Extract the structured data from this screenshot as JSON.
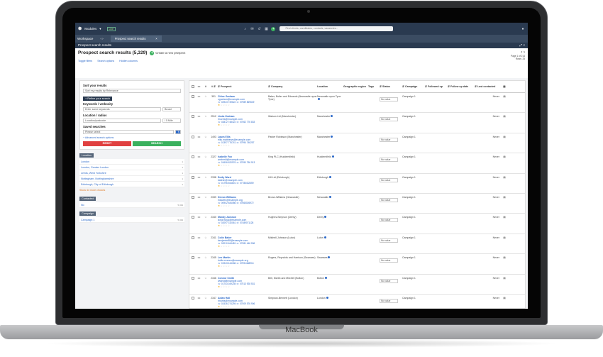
{
  "device": {
    "brand": "MacBook"
  },
  "topbar": {
    "modules_label": "Modules",
    "tag_label": "Live",
    "search_placeholder": "Find clients, candidates, contacts, vacancies..."
  },
  "tabs": {
    "workspace_label": "Workspace",
    "active_tab_label": "Prospect search results",
    "close_glyph": "×"
  },
  "window": {
    "title": "Prospect search results"
  },
  "header": {
    "title": "Prospect search results (5,329)",
    "add_label": "Create a new prospect",
    "links": [
      "Toggle filters",
      "Search options",
      "Hidden columns"
    ],
    "pager_line1": "Page 1 of 214",
    "pager_line2": "Rows: 25"
  },
  "sidebar": {
    "sort_label": "Sort your results",
    "sort_value": "Sort my results by Relevance",
    "refine_label": "+ Refine your search",
    "keywords_label": "Keywords / verbosity",
    "keywords_placeholder": "Enter some keywords",
    "verbosity_value": "Broad",
    "location_label": "Location / radius",
    "location_placeholder": "Location/postcode",
    "radius_value": "/ 5 Mile",
    "saved_label": "Saved searches",
    "saved_placeholder": "Please select",
    "advanced_link": "+ Advanced search options",
    "reset_label": "RESET",
    "search_label": "SEARCH",
    "location_filter": {
      "header": "Location",
      "items": [
        {
          "label": "London",
          "count": "1"
        },
        {
          "label": "London, Greater London",
          "count": "1"
        },
        {
          "label": "Leeds, West Yorkshire",
          "count": "1"
        },
        {
          "label": "Nottingham, Nottinghamshire",
          "count": "1"
        },
        {
          "label": "Edinburgh, City of Edinburgh",
          "count": "1"
        }
      ],
      "more_label": "Show 44 more choices"
    },
    "contacted_filter": {
      "header": "Contacted",
      "items": [
        {
          "label": "No",
          "count": "5,329"
        }
      ]
    },
    "campaign_filter": {
      "header": "Campaign",
      "items": [
        {
          "label": "Campaign 1",
          "count": "5,329"
        }
      ]
    }
  },
  "table": {
    "headers": [
      "",
      "",
      "#",
      "# ⇵",
      "⇵ Prospect",
      "⇵ Company",
      "Location",
      "Geographic region",
      "Tags",
      "⇵ Status",
      "⇵ Campaign",
      "⇵ Followed up",
      "⇵ Follow up date",
      "⇵ Last contacted",
      ""
    ],
    "status_value": "No value",
    "rows": [
      {
        "id": "351",
        "name": "Chloe Graham",
        "email": "cgraham@example.com",
        "phones": "☏ 02923 749622  ☏ 07989 869649",
        "stars": 1,
        "company": "Baker, Butler and Edwards (Newcastle upon Tyne)",
        "location": "Newcastle upon Tyne",
        "campaign": "Campaign 1",
        "last": "Never"
      },
      {
        "id": "2512",
        "name": "Linda Graham",
        "email": "lmorris@example.com",
        "phones": "☏ 02812 748422  ☏ 07062 776 833",
        "stars": 1,
        "company": "Watson Ltd (Manchester)",
        "location": "Manchester",
        "campaign": "Campaign 1",
        "last": "Never"
      },
      {
        "id": "1493",
        "name": "Laura Ellis",
        "email": "ellis.matthews@example.com",
        "phones": "☏ 01397 776741  ☏ 07994 746257",
        "stars": 1,
        "company": "Parker Robinson (Manchester)",
        "location": "Manchester",
        "campaign": "Campaign 1",
        "last": "Never"
      },
      {
        "id": "2327",
        "name": "Isabelle Fox",
        "email": "amberld@example.com",
        "phones": "☏ 01606 620976  ☏ 07090 756 913",
        "stars": 1,
        "company": "King PLC (Huddersfield)",
        "location": "Huddersfield",
        "campaign": "Campaign 1",
        "last": "Never"
      },
      {
        "id": "2338",
        "name": "Emily Ward",
        "email": "katesh@example.com",
        "phones": "☏ 01796 464801  ☏ 07786432659",
        "stars": 1,
        "company": "Hill Ltd (Edinburgh)",
        "location": "Edinburgh",
        "campaign": "Campaign 1",
        "last": "Never"
      },
      {
        "id": "2339",
        "name": "Kieran Williams",
        "email": "edavies@example.org",
        "phones": "☏ 00902 484086  ☏ 07665026972",
        "stars": 1,
        "company": "Brown-Williams (Newcastle)",
        "location": "Newcastle",
        "campaign": "Campaign 1",
        "last": "Never"
      },
      {
        "id": "2340",
        "name": "Mandy Jackson",
        "email": "lloyd.fraya@example.com",
        "phones": "☏ 02097 310061  ☏ 07489071128",
        "stars": 1,
        "company": "Hughes-Simpson (Derby)",
        "location": "Derby",
        "campaign": "Campaign 1",
        "last": "Never"
      },
      {
        "id": "2341",
        "name": "Colin Baker",
        "email": "benjamin88@example.com",
        "phones": "☏ 02010 464481  ☏ 07081 446 536",
        "stars": 1,
        "company": "Mitchell-Johnson (Luton)",
        "location": "Luton",
        "campaign": "Campaign 1",
        "last": "Never"
      },
      {
        "id": "2345",
        "name": "Leo Martin",
        "email": "hollie.evereu@example.org",
        "phones": "☏ 01943 444186  ☏ 07591468916",
        "stars": 1,
        "company": "Rogers, Reynolds and Harrison (Swansea)",
        "location": "Swansea",
        "campaign": "Campaign 1",
        "last": "Never"
      },
      {
        "id": "2346",
        "name": "Connor Smith",
        "email": "wwest@example.com",
        "phones": "☏ 01743 169235  ☏ 07513 928 531",
        "stars": 1,
        "company": "Bell, Martin and Mitchell (Bolton)",
        "location": "Bolton",
        "campaign": "Campaign 1",
        "last": "Never"
      },
      {
        "id": "2347",
        "name": "Aidan Hall",
        "email": "hhurtis@example.com",
        "phones": "☏ 02436 274294  ☏ 07009 576 906",
        "stars": 1,
        "company": "Simpson-Bennett (London)",
        "location": "London",
        "campaign": "Campaign 1",
        "last": "Never"
      }
    ]
  },
  "colors": {
    "accent": "#2c69c9",
    "nav": "#2a3a50",
    "reset": "#e04040",
    "search": "#3ab15e",
    "star": "#f0a500"
  }
}
